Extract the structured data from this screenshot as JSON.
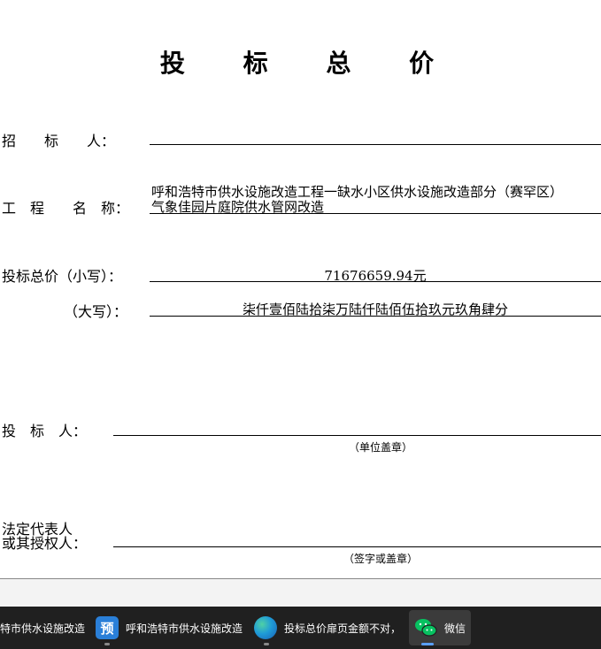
{
  "document": {
    "title": "投  标  总  价",
    "tenderer_label": "招　　标　　人：",
    "project_label": "工　程　　名　称：",
    "project_name_line1": "呼和浩特市供水设施改造工程一缺水小区供水设施改造部分（赛罕区）",
    "project_name_line2": "气象佳园片庭院供水管网改造",
    "price_small_label": "投标总价（小写）：",
    "price_small_value": "71676659.94元",
    "price_big_label": "（大写）：",
    "price_big_value": "柒仟壹佰陆拾柒万陆仟陆佰伍拾玖元玖角肆分",
    "bidder_label": "投　标　人：",
    "bidder_note": "（单位盖章）",
    "legal_label_line1": "法定代表人",
    "legal_label_line2": "或其授权人：",
    "legal_note": "（签字或盖章）"
  },
  "taskbar": {
    "items": [
      {
        "label": "特市供水设施改造"
      },
      {
        "icon_text": "预",
        "label": "呼和浩特市供水设施改造"
      },
      {
        "label": "投标总价扉页金额不对，"
      },
      {
        "label": "微信"
      }
    ],
    "colors": {
      "bg": "#202020",
      "preview_icon": "#2a7fd8",
      "wechat": "#07c160"
    }
  }
}
